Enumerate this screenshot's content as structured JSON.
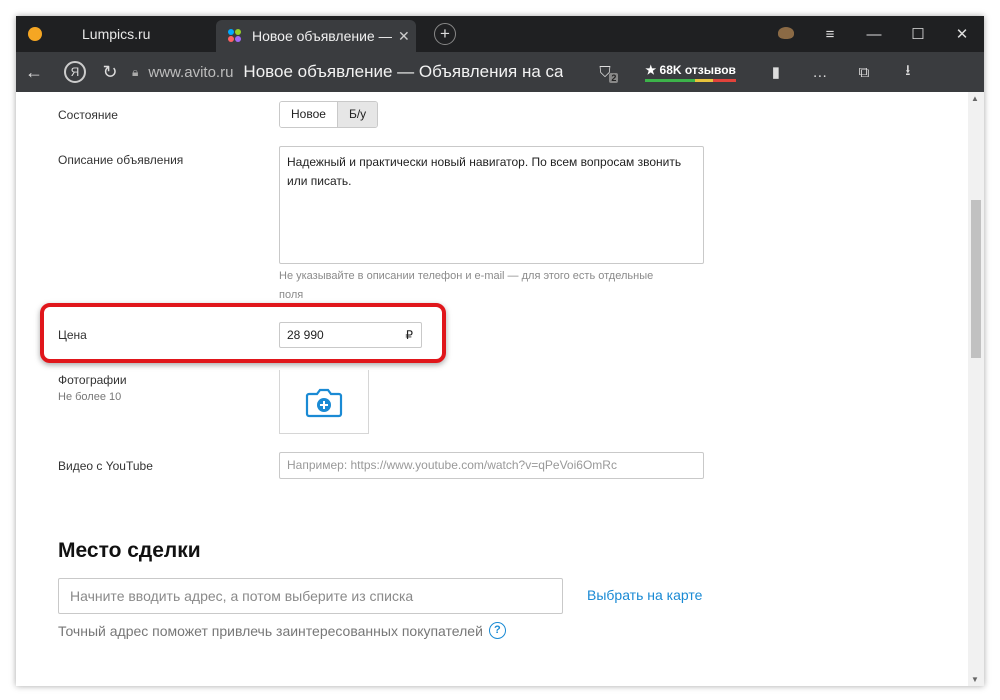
{
  "browser": {
    "tabs": [
      {
        "title": "Lumpics.ru",
        "favicon": "orange-circle-icon"
      },
      {
        "title": "Новое объявление — О",
        "favicon": "avito-dots-icon",
        "active": true
      }
    ],
    "window_controls": {
      "menu": "≡",
      "minimize": "—",
      "maximize": "☐",
      "close": "✕"
    },
    "domain": "www.avito.ru",
    "page_title": "Новое объявление — Объявления на са...",
    "protect_badge": "2",
    "reviews": "★ 68K отзывов"
  },
  "form": {
    "condition": {
      "label": "Состояние",
      "options": [
        "Новое",
        "Б/у"
      ],
      "selected": "Новое"
    },
    "description": {
      "label": "Описание объявления",
      "value": "Надежный и практически новый навигатор. По всем вопросам звонить или писать.",
      "hint": "Не указывайте в описании телефон и e-mail — для этого есть отдельные поля"
    },
    "price": {
      "label": "Цена",
      "value": "28 990",
      "currency": "₽"
    },
    "photos": {
      "label": "Фотографии",
      "sublabel": "Не более 10"
    },
    "video": {
      "label": "Видео с YouTube",
      "placeholder": "Например: https://www.youtube.com/watch?v=qPeVoi6OmRc"
    }
  },
  "location": {
    "heading": "Место сделки",
    "placeholder": "Начните вводить адрес, а потом выберите из списка",
    "map_link": "Выбрать на карте",
    "hint": "Точный адрес поможет привлечь заинтересованных покупателей"
  },
  "colors": {
    "accent": "#1a8ad4",
    "highlight": "#e0161b"
  }
}
